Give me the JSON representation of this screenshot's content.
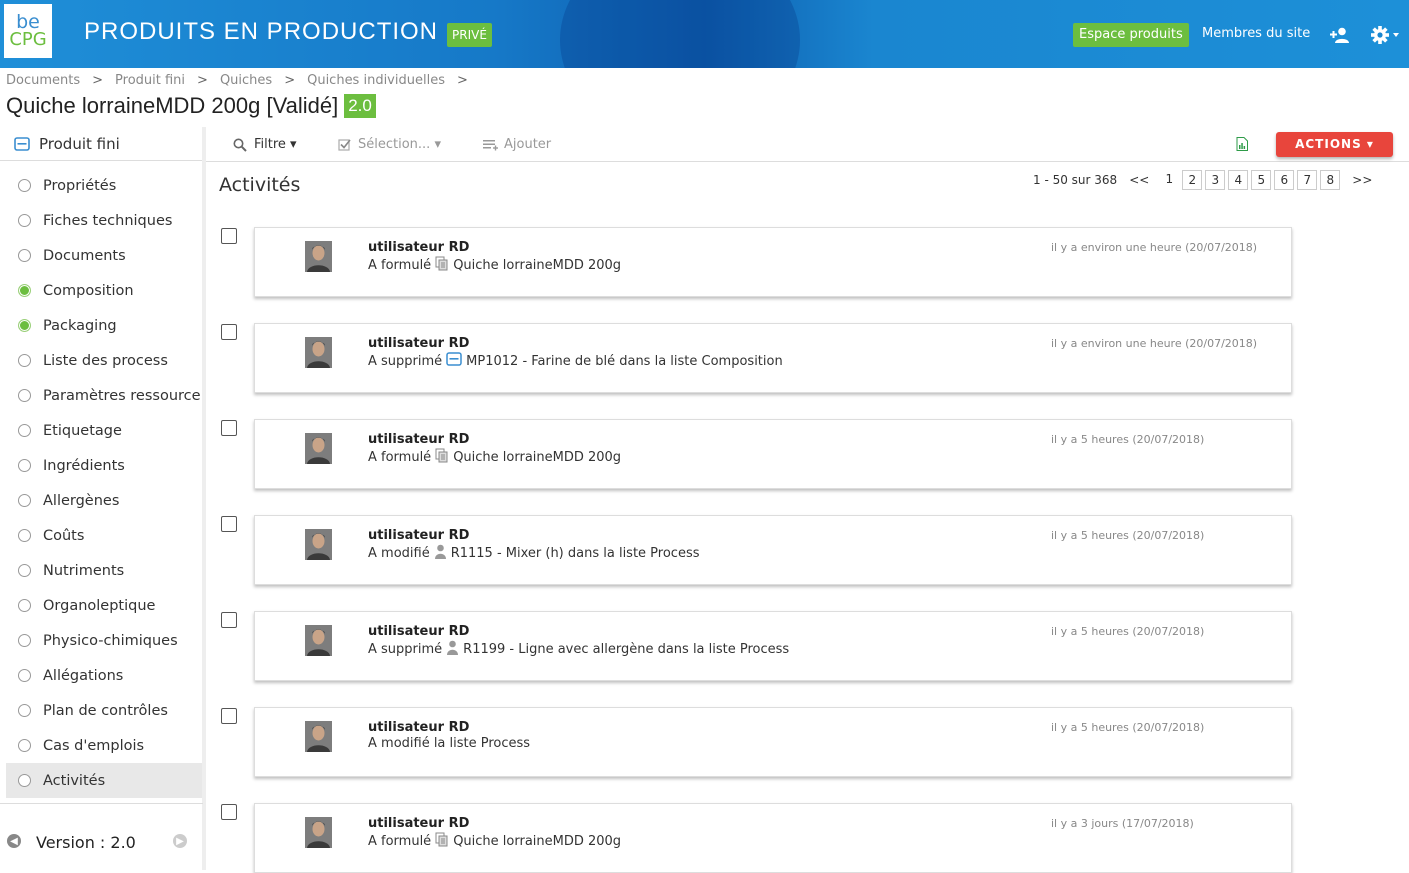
{
  "header": {
    "logo_top": "be",
    "logo_bottom": "CPG",
    "site_title": "PRODUITS EN PRODUCTION",
    "visibility_badge": "PRIVÉ",
    "espace_button": "Espace produits",
    "members_link": "Membres du site",
    "icons": [
      "add-user-icon",
      "gear-icon"
    ]
  },
  "breadcrumb": [
    "Documents",
    "Produit fini",
    "Quiches",
    "Quiches individuelles"
  ],
  "breadcrumb_sep": ">",
  "page": {
    "title": "Quiche lorraineMDD 200g [Validé]",
    "version": "2.0"
  },
  "sidebar": {
    "header": "Produit fini",
    "items": [
      {
        "label": "Propriétés",
        "state": "empty"
      },
      {
        "label": "Fiches techniques",
        "state": "empty"
      },
      {
        "label": "Documents",
        "state": "empty"
      },
      {
        "label": "Composition",
        "state": "green"
      },
      {
        "label": "Packaging",
        "state": "green"
      },
      {
        "label": "Liste des process",
        "state": "empty"
      },
      {
        "label": "Paramètres ressource",
        "state": "empty"
      },
      {
        "label": "Etiquetage",
        "state": "empty"
      },
      {
        "label": "Ingrédients",
        "state": "empty"
      },
      {
        "label": "Allergènes",
        "state": "empty"
      },
      {
        "label": "Coûts",
        "state": "empty"
      },
      {
        "label": "Nutriments",
        "state": "empty"
      },
      {
        "label": "Organoleptique",
        "state": "empty"
      },
      {
        "label": "Physico-chimiques",
        "state": "empty"
      },
      {
        "label": "Allégations",
        "state": "empty"
      },
      {
        "label": "Plan de contrôles",
        "state": "empty"
      },
      {
        "label": "Cas d'emplois",
        "state": "empty"
      },
      {
        "label": "Activités",
        "state": "empty",
        "active": true
      }
    ],
    "version_label": "Version : 2.0"
  },
  "toolbar": {
    "filter": "Filtre ▾",
    "selection": "Sélection... ▾",
    "add": "Ajouter",
    "actions": "ACTIONS ▾"
  },
  "content": {
    "title": "Activités",
    "pagination": {
      "range": "1 - 50 sur 368",
      "prev": "<<",
      "current": "1",
      "pages": [
        "2",
        "3",
        "4",
        "5",
        "6",
        "7",
        "8"
      ],
      "next": ">>"
    },
    "activities": [
      {
        "user": "utilisateur RD",
        "verb": "A formulé",
        "icon": "document-icon",
        "target": "Quiche lorraineMDD 200g",
        "date": "il y a environ une heure (20/07/2018)"
      },
      {
        "user": "utilisateur RD",
        "verb": "A supprimé",
        "icon": "raw-material-icon",
        "target": "MP1012 - Farine de blé dans la liste Composition",
        "date": "il y a environ une heure (20/07/2018)"
      },
      {
        "user": "utilisateur RD",
        "verb": "A formulé",
        "icon": "document-icon",
        "target": "Quiche lorraineMDD 200g",
        "date": "il y a 5 heures (20/07/2018)"
      },
      {
        "user": "utilisateur RD",
        "verb": "A modifié",
        "icon": "resource-icon",
        "target": "R1115 - Mixer (h) dans la liste Process",
        "date": "il y a 5 heures (20/07/2018)"
      },
      {
        "user": "utilisateur RD",
        "verb": "A supprimé",
        "icon": "resource-icon",
        "target": "R1199 - Ligne avec allergène dans la liste Process",
        "date": "il y a 5 heures (20/07/2018)"
      },
      {
        "user": "utilisateur RD",
        "verb": "A modifié la liste Process",
        "icon": "",
        "target": "",
        "date": "il y a 5 heures (20/07/2018)"
      },
      {
        "user": "utilisateur RD",
        "verb": "A formulé",
        "icon": "document-icon",
        "target": "Quiche lorraineMDD 200g",
        "date": "il y a 3 jours (17/07/2018)"
      }
    ]
  }
}
